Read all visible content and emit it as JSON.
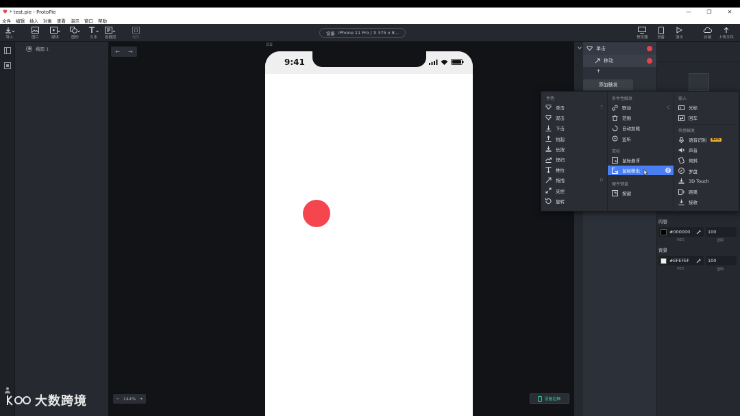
{
  "window": {
    "title": "* test.pie - ProtoPie",
    "controls": [
      "—",
      "❐",
      "✕"
    ]
  },
  "menu": [
    "文件",
    "编辑",
    "插入",
    "对象",
    "查看",
    "演示",
    "窗口",
    "帮助"
  ],
  "toolbar": {
    "left": [
      {
        "label": "导入",
        "icon": "import-icon"
      },
      {
        "label": "图片",
        "icon": "image-icon"
      },
      {
        "label": "媒体",
        "icon": "media-icon"
      },
      {
        "label": "图形",
        "icon": "shape-icon"
      },
      {
        "label": "文本",
        "icon": "text-icon"
      },
      {
        "label": "容器层",
        "icon": "container-icon"
      },
      {
        "label": "组件",
        "icon": "component-icon"
      }
    ],
    "device": {
      "label": "设备",
      "value": "iPhone 11 Pro / X  375 x 8..."
    },
    "right": [
      {
        "label": "预览器",
        "icon": "preview-icon"
      },
      {
        "label": "设备",
        "icon": "device-icon"
      },
      {
        "label": "演示",
        "icon": "play-icon"
      },
      {
        "label": "云端",
        "icon": "cloud-icon"
      },
      {
        "label": "上传文件",
        "icon": "upload-icon"
      }
    ]
  },
  "layers": {
    "items": [
      {
        "name": "椭圆 1",
        "icon": "ellipse-icon"
      }
    ]
  },
  "canvas": {
    "nav_back": "←",
    "nav_forward": "→",
    "zoom": {
      "minus": "−",
      "value": "144%",
      "plus": "+"
    },
    "device_frame_label": "设备边框",
    "phone_label": "屏幕",
    "phone": {
      "time": "9:41"
    },
    "circle_color": "#F5454F"
  },
  "triggers": {
    "items": [
      {
        "label": "单击",
        "icon": "tap-icon"
      },
      {
        "label": "移动",
        "icon": "move-icon"
      }
    ],
    "add_response": "+",
    "add_button": "添加触发"
  },
  "properties": {
    "content": {
      "label": "内容",
      "hex": "#000000",
      "opacity": "100",
      "hex_label": "HEX",
      "opacity_label": "透明"
    },
    "background": {
      "label": "背景",
      "hex": "#EFEFEF",
      "opacity": "100",
      "hex_label": "HEX",
      "opacity_label": "透明"
    }
  },
  "trigger_menu": {
    "gestures": {
      "heading": "手势",
      "items": [
        {
          "label": "单击",
          "icon": "tap-icon",
          "shortcut": "T"
        },
        {
          "label": "双击",
          "icon": "double-tap-icon",
          "shortcut": ""
        },
        {
          "label": "下击",
          "icon": "touch-down-icon",
          "shortcut": ""
        },
        {
          "label": "抬起",
          "icon": "touch-up-icon",
          "shortcut": ""
        },
        {
          "label": "长按",
          "icon": "long-press-icon",
          "shortcut": ""
        },
        {
          "label": "快扫",
          "icon": "swipe-icon",
          "shortcut": ""
        },
        {
          "label": "推拉",
          "icon": "pull-icon",
          "shortcut": ""
        },
        {
          "label": "拖拽",
          "icon": "drag-icon",
          "shortcut": "D"
        },
        {
          "label": "夹捏",
          "icon": "pinch-icon",
          "shortcut": ""
        },
        {
          "label": "旋转",
          "icon": "rotate-icon",
          "shortcut": ""
        }
      ]
    },
    "conditional": {
      "heading": "条件性触发",
      "items": [
        {
          "label": "联动",
          "icon": "chain-icon",
          "shortcut": "C"
        },
        {
          "label": "范围",
          "icon": "range-icon",
          "shortcut": ""
        },
        {
          "label": "自动加载",
          "icon": "auto-load-icon",
          "shortcut": ""
        },
        {
          "label": "监听",
          "icon": "detect-icon",
          "shortcut": ""
        }
      ]
    },
    "mouse": {
      "heading": "鼠标",
      "items": [
        {
          "label": "鼠标悬浮",
          "icon": "hover-icon"
        },
        {
          "label": "鼠标移出",
          "icon": "hover-out-icon"
        }
      ]
    },
    "keyboard": {
      "heading": "硬件键盘",
      "items": [
        {
          "label": "按键",
          "icon": "key-icon"
        }
      ]
    },
    "input": {
      "heading": "输入",
      "items": [
        {
          "label": "光标",
          "icon": "cursor-icon"
        },
        {
          "label": "回车",
          "icon": "return-icon"
        }
      ]
    },
    "sensor": {
      "heading": "传感触发",
      "items": [
        {
          "label": "语音识别",
          "icon": "mic-icon",
          "badge": "Beta"
        },
        {
          "label": "声音",
          "icon": "sound-icon"
        },
        {
          "label": "倾斜",
          "icon": "tilt-icon"
        },
        {
          "label": "罗盘",
          "icon": "compass-icon"
        },
        {
          "label": "3D Touch",
          "icon": "3d-touch-icon"
        },
        {
          "label": "距离",
          "icon": "proximity-icon"
        },
        {
          "label": "接收",
          "icon": "receive-icon"
        }
      ]
    },
    "highlight_color": "#4A7EF5"
  },
  "watermark": {
    "text": "大数跨境"
  }
}
